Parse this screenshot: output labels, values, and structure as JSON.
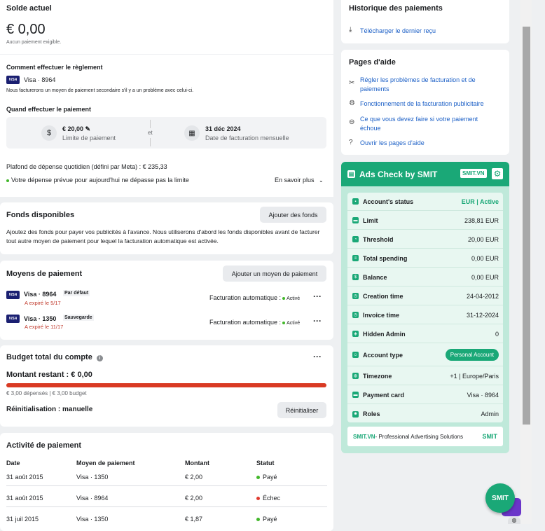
{
  "balance": {
    "title": "Solde actuel",
    "amount": "€ 0,00",
    "subtitle": "Aucun paiement exigible.",
    "how_title": "Comment effectuer le règlement",
    "card_label": "Visa · 8964",
    "note": "Nous facturerons un moyen de paiement secondaire s'il y a un problème avec celui-ci.",
    "when_title": "Quand effectuer le paiement",
    "limit_value": "€ 20,00",
    "limit_label": "Limite de paiement",
    "et": "et",
    "date_value": "31 déc 2024",
    "date_label": "Date de facturation mensuelle",
    "daily_cap": "Plafond de dépense quotidien (défini par Meta) : € 235,33",
    "daily_note": "Votre dépense prévue pour aujourd'hui ne dépasse pas la limite",
    "learn_more": "En savoir plus"
  },
  "funds": {
    "title": "Fonds disponibles",
    "add_button": "Ajouter des fonds",
    "description": "Ajoutez des fonds pour payer vos publicités à l'avance. Nous utiliserons d'abord les fonds disponibles avant de facturer tout autre moyen de paiement pour lequel la facturation automatique est activée."
  },
  "methods": {
    "title": "Moyens de paiement",
    "add_button": "Ajouter un moyen de paiement",
    "items": [
      {
        "label": "Visa · 8964",
        "badge": "Par défaut",
        "expiry": "A expiré le 5/17",
        "auto_label": "Facturation automatique :",
        "auto_status": "Activé"
      },
      {
        "label": "Visa · 1350",
        "badge": "Sauvegarde",
        "expiry": "A expiré le 11/17",
        "auto_label": "Facturation automatique :",
        "auto_status": "Activé"
      }
    ]
  },
  "budget": {
    "title": "Budget total du compte",
    "remaining": "Montant restant : € 0,00",
    "progress_fraction": 1.0,
    "spent_note": "€ 3,00 dépensés | € 3,00 budget",
    "reset_label": "Réinitialisation : manuelle",
    "reset_button": "Réinitialiser"
  },
  "activity": {
    "title": "Activité de paiement",
    "headers": [
      "Date",
      "Moyen de paiement",
      "Montant",
      "Statut"
    ],
    "rows": [
      {
        "date": "31 août 2015",
        "method": "Visa · 1350",
        "amount": "€ 2,00",
        "status": "Payé",
        "status_color": "#42b72a"
      },
      {
        "date": "31 août 2015",
        "method": "Visa · 8964",
        "amount": "€ 2,00",
        "status": "Échec",
        "status_color": "#e03a2f"
      },
      {
        "date": "31 juil 2015",
        "method": "Visa · 1350",
        "amount": "€ 1,87",
        "status": "Payé",
        "status_color": "#42b72a"
      }
    ]
  },
  "history": {
    "title": "Historique des paiements",
    "download": "Télécharger le dernier reçu"
  },
  "help": {
    "title": "Pages d'aide",
    "links": [
      "Régler les problèmes de facturation et de paiements",
      "Fonctionnement de la facturation publicitaire",
      "Ce que vous devez faire si votre paiement échoue",
      "Ouvrir les pages d'aide"
    ]
  },
  "smit": {
    "title": "Ads Check by SMIT",
    "badge": "SMIT.VN",
    "rows": [
      {
        "label": "Account's status",
        "value": "EUR | Active"
      },
      {
        "label": "Limit",
        "value": "238,81 EUR"
      },
      {
        "label": "Threshold",
        "value": "20,00 EUR"
      },
      {
        "label": "Total spending",
        "value": "0,00 EUR"
      },
      {
        "label": "Balance",
        "value": "0,00 EUR"
      },
      {
        "label": "Creation time",
        "value": "24-04-2012"
      },
      {
        "label": "Invoice time",
        "value": "31-12-2024"
      },
      {
        "label": "Hidden Admin",
        "value": "0"
      },
      {
        "label": "Account type",
        "value": "Personal Account"
      },
      {
        "label": "Timezone",
        "value": "+1 | Europe/Paris"
      },
      {
        "label": "Payment card",
        "value": "Visa · 8964"
      },
      {
        "label": "Roles",
        "value": "Admin"
      }
    ],
    "footer_brand": "SMIT.VN",
    "footer_text": " - Professional Advertising Solutions",
    "footer_logo": "SMIT",
    "fab": "SMIT"
  },
  "colors": {
    "accent_green": "#1aa877",
    "link_blue": "#1b5fc6",
    "progress_red": "#d93a23"
  }
}
